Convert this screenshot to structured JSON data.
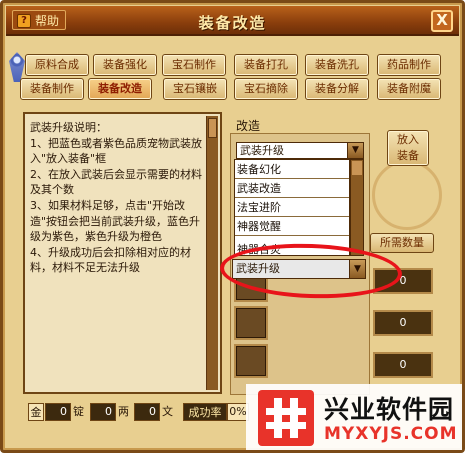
{
  "window": {
    "title": "装备改造",
    "help_label": "帮助",
    "help_icon": "?",
    "close_glyph": "X"
  },
  "tabs_row1": [
    {
      "label": "原料合成"
    },
    {
      "label": "装备强化"
    },
    {
      "label": "宝石制作"
    },
    {
      "label": "装备打孔"
    },
    {
      "label": "装备洗孔"
    },
    {
      "label": "药品制作"
    }
  ],
  "tabs_row2": [
    {
      "label": "装备制作"
    },
    {
      "label": "装备改造",
      "active": true
    },
    {
      "label": "宝石镶嵌"
    },
    {
      "label": "宝石摘除"
    },
    {
      "label": "装备分解"
    },
    {
      "label": "装备附魔"
    }
  ],
  "instructions": {
    "text": "武装升级说明：\n1、把蓝色或者紫色品质宠物武装放入\"放入装备\"框\n2、在放入武装后会显示需要的材料及其个数\n3、如果材料足够，点击\"开始改造\"按钮会把当前武装升级，蓝色升级为紫色，紫色升级为橙色\n4、升级成功后会扣除相对应的材料，材料不足无法升级"
  },
  "upgrade": {
    "section_label": "改造",
    "put_in_button": "放入\n装备",
    "required_qty_button": "所需数量",
    "dropdown_selected": "武装升级",
    "dropdown_options": [
      "装备幻化",
      "武装改造",
      "法宝进阶",
      "神器觉醒",
      "神器合炎"
    ],
    "dropdown2_selected": "武装升级",
    "qty_values": [
      "0",
      "0",
      "0"
    ]
  },
  "currency": {
    "gold_label": "金",
    "gold_value": "0",
    "ingot_label": "锭",
    "silver_value": "0",
    "tael_label": "两",
    "copper_value": "0",
    "wen_label": "文"
  },
  "success_rate": {
    "label": "成功率",
    "value": "0%"
  },
  "watermark": {
    "title": "兴业软件园",
    "url": "MYXYJS.COM"
  },
  "colors": {
    "frame": "#7a4a17",
    "titlebar": "#8a3e0c",
    "panel": "#e8cf90",
    "annotation": "#e8141a"
  }
}
